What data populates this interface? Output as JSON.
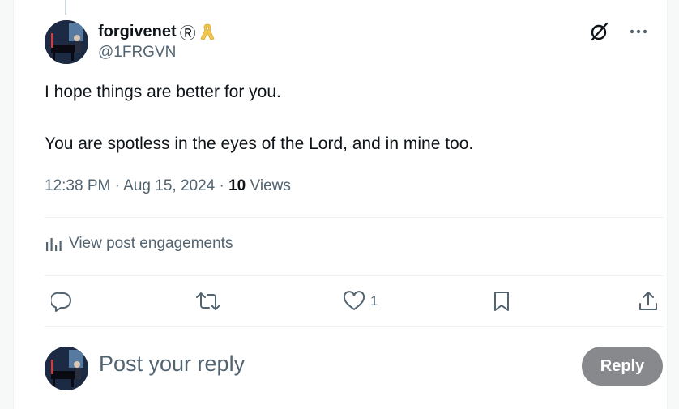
{
  "post": {
    "author": {
      "display_name": "forgivenet",
      "registered_mark": "Ⓡ",
      "badge_icon": "yellow-ribbon-icon",
      "handle": "@1FRGVN"
    },
    "text": {
      "line1": "I hope things are better for you.",
      "line2": "You are spotless in the eyes of the Lord, and in mine too."
    },
    "meta": {
      "time": "12:38 PM",
      "separator": "·",
      "date": "Aug 15, 2024",
      "views_count": "10",
      "views_label": "Views"
    },
    "engagements_label": "View post engagements",
    "actions": {
      "like_count": "1"
    }
  },
  "reply_box": {
    "placeholder": "Post your reply",
    "button_label": "Reply"
  },
  "colors": {
    "text_primary": "#0f1419",
    "text_secondary": "#536471",
    "divider": "#eff3f4",
    "reply_button": "#87898c",
    "ribbon": "#f2c94c"
  }
}
